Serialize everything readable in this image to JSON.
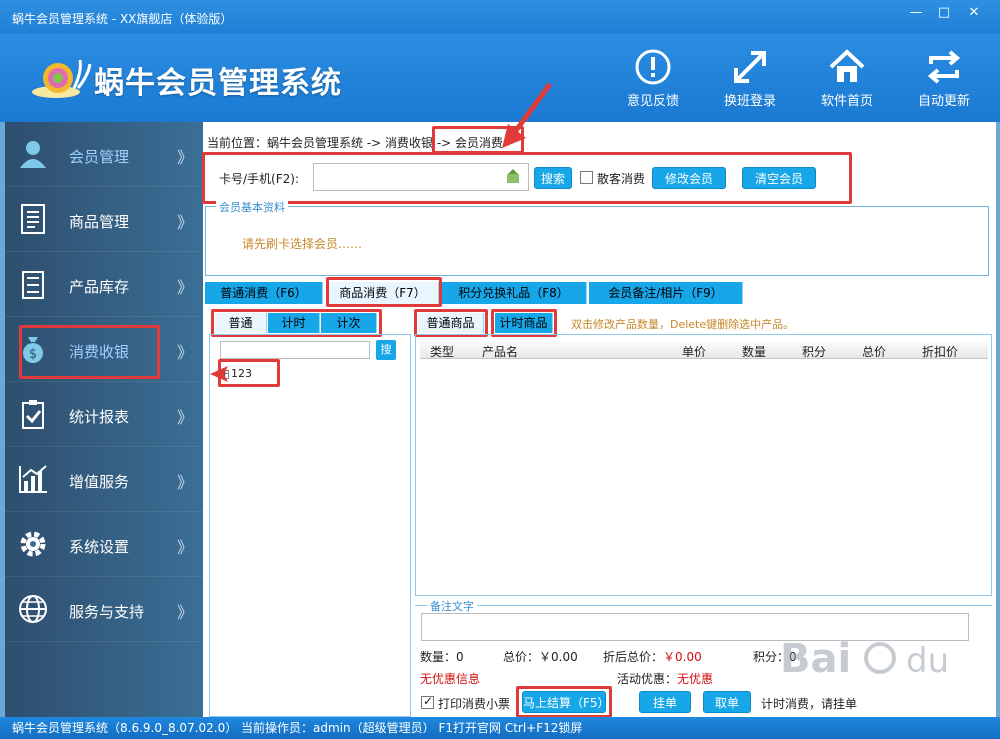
{
  "window": {
    "title": "蜗牛会员管理系统 - XX旗舰店（体验版）",
    "controls": [
      "—",
      "□",
      "✕"
    ]
  },
  "header": {
    "app_name": "蜗牛会员管理系统",
    "tools": [
      {
        "label": "意见反馈",
        "icon": "info-icon"
      },
      {
        "label": "换班登录",
        "icon": "expand-arrows-icon"
      },
      {
        "label": "软件首页",
        "icon": "home-icon"
      },
      {
        "label": "自动更新",
        "icon": "refresh-icon"
      }
    ]
  },
  "sidebar": {
    "items": [
      {
        "label": "会员管理",
        "icon": "member-icon",
        "chev": "》"
      },
      {
        "label": "商品管理",
        "icon": "document-icon",
        "chev": "》"
      },
      {
        "label": "产品库存",
        "icon": "cabinet-icon",
        "chev": "》"
      },
      {
        "label": "消费收银",
        "icon": "money-bag-icon",
        "chev": "》"
      },
      {
        "label": "统计报表",
        "icon": "clipboard-icon",
        "chev": "》"
      },
      {
        "label": "增值服务",
        "icon": "chart-icon",
        "chev": "》"
      },
      {
        "label": "系统设置",
        "icon": "gear-icon",
        "chev": "》"
      },
      {
        "label": "服务与支持",
        "icon": "globe-icon",
        "chev": "》"
      }
    ]
  },
  "breadcrumb": "当前位置：蜗牛会员管理系统 -> 消费收银 -> 会员消费",
  "search": {
    "label": "卡号/手机(F2):",
    "value": "",
    "search_button": "搜索",
    "walkin_label": "散客消费",
    "edit_button": "修改会员",
    "clear_button": "清空会员"
  },
  "member_info": {
    "legend": "会员基本资料",
    "hint": "请先刷卡选择会员……"
  },
  "tabs": [
    "普通消费（F6）",
    "商品消费（F7）",
    "积分兑换礼品（F8）",
    "会员备注/相片（F9）"
  ],
  "left_subtabs": [
    "普通",
    "计时",
    "计次"
  ],
  "right_subtabs": [
    "普通商品",
    "计时商品"
  ],
  "tree": {
    "search_button": "搜",
    "nodes": [
      "123"
    ]
  },
  "hint": "双击修改产品数量，Delete键删除选中产品。",
  "grid": {
    "columns": [
      "类型",
      "产品名",
      "单价",
      "数量",
      "积分",
      "总价",
      "折扣价"
    ]
  },
  "remark": {
    "legend": "备注文字"
  },
  "summary": {
    "qty": "数量：0",
    "total": "总价：￥0.00",
    "discount_total_label": "折后总价：",
    "discount_total_value": "￥0.00",
    "points": "积分：0",
    "no_discount": "无优惠信息",
    "activity_label": "活动优惠：",
    "activity_value": "无优惠"
  },
  "actions": {
    "print_label": "打印消费小票",
    "checkout_button": "马上结算（F5）",
    "hang_button": "挂单",
    "take_button": "取单",
    "tip": "计时消费，请挂单"
  },
  "statusbar": "蜗牛会员管理系统（8.6.9.0_8.07.02.0）  当前操作员：admin（超级管理员）  F1打开官网 Ctrl+F12锁屏",
  "colors": {
    "accent": "#17a6e8",
    "header": "#1f7fd6",
    "sidebar": "#2e4e6e",
    "annotation": "#e03a3a",
    "warning_text": "#c8872a"
  }
}
